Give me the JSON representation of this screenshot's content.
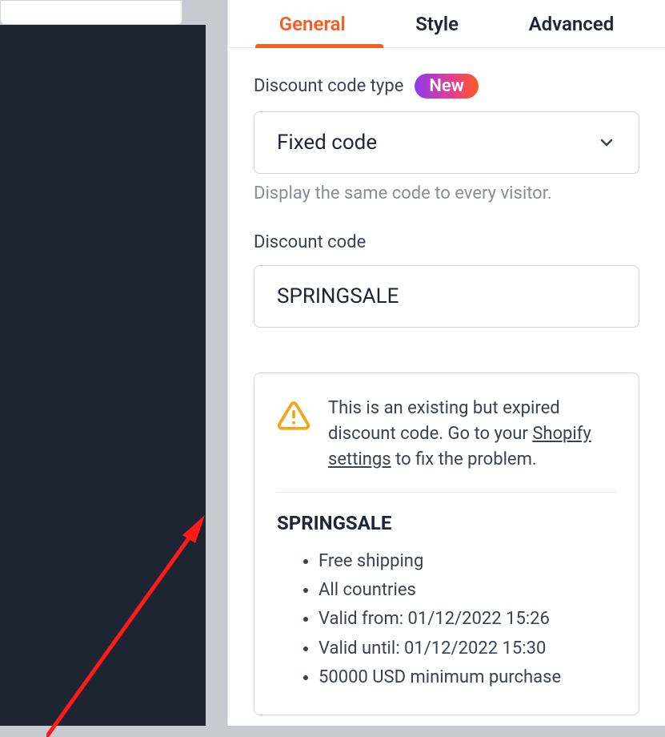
{
  "tabs": {
    "general": "General",
    "style": "Style",
    "advanced": "Advanced"
  },
  "discount_type": {
    "label": "Discount code type",
    "badge": "New",
    "value": "Fixed code",
    "helper": "Display the same code to every visitor."
  },
  "discount_code": {
    "label": "Discount code",
    "value": "SPRINGSALE"
  },
  "alert": {
    "text_before": "This is an existing but expired discount code. Go to your ",
    "link": "Shopify settings",
    "text_after": " to fix the problem."
  },
  "details": {
    "code": "SPRINGSALE",
    "items": [
      "Free shipping",
      "All countries",
      "Valid from: 01/12/2022 15:26",
      "Valid until: 01/12/2022 15:30",
      "50000 USD minimum purchase"
    ]
  }
}
